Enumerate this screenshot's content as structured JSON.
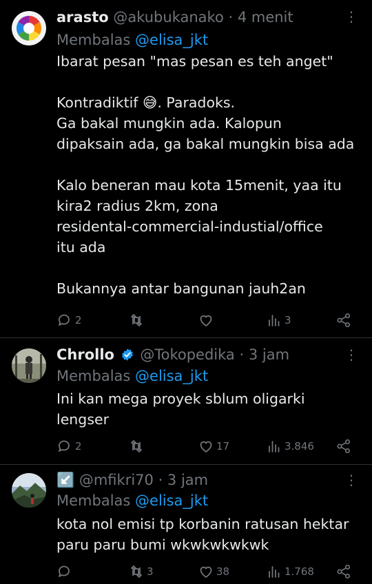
{
  "tweets": [
    {
      "name": "arasto",
      "handle": "@akubukanako",
      "time": "· 4 menit",
      "reply_prefix": "Membalas",
      "reply_to": "@elisa_jkt",
      "lines": [
        "Ibarat pesan \"mas pesan es teh anget\"",
        "",
        "Kontradiktif 😅. Paradoks.",
        "Ga bakal mungkin ada. Kalopun",
        "dipaksain ada, ga bakal mungkin bisa ada",
        "",
        "Kalo beneran mau kota 15menit, yaa itu",
        "kira2 radius 2km, zona",
        "residental-commercial-industial/office",
        "itu ada",
        "",
        "Bukannya antar bangunan jauh2an"
      ],
      "stats": {
        "replies": "2",
        "reposts": "",
        "likes": "",
        "views": "3"
      }
    },
    {
      "name": "Chrollo",
      "handle": "@Tokopedika",
      "time": "· 3 jam",
      "reply_prefix": "Membalas",
      "reply_to": "@elisa_jkt",
      "lines": [
        "Ini kan mega proyek sblum oligarki",
        "lengser"
      ],
      "stats": {
        "replies": "2",
        "reposts": "",
        "likes": "17",
        "views": "3.846"
      }
    },
    {
      "name": "↙️",
      "handle": "@mfikri70",
      "time": "· 3 jam",
      "reply_prefix": "Membalas",
      "reply_to": "@elisa_jkt",
      "lines": [
        "kota nol emisi tp korbanin ratusan hektar",
        "paru paru bumi wkwkwkwkwk"
      ],
      "stats": {
        "replies": "",
        "reposts": "3",
        "likes": "38",
        "views": "1.768"
      }
    }
  ],
  "colors": {
    "background": "#000000",
    "text": "#e7e9ea",
    "muted": "#71767b",
    "link": "#1d9bf0",
    "verified": "#1d9bf0"
  }
}
